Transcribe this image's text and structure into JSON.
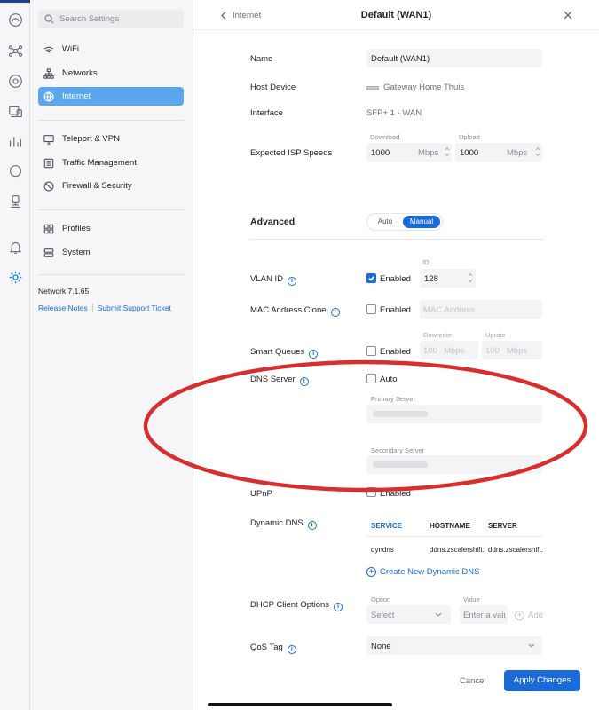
{
  "sidebar": {
    "search_placeholder": "Search Settings",
    "items": [
      {
        "label": "WiFi",
        "icon": "wifi-icon"
      },
      {
        "label": "Networks",
        "icon": "network-tree-icon"
      },
      {
        "label": "Internet",
        "icon": "globe-icon",
        "active": true
      },
      {
        "label": "Teleport & VPN",
        "icon": "monitor-icon"
      },
      {
        "label": "Traffic Management",
        "icon": "traffic-list-icon"
      },
      {
        "label": "Firewall & Security",
        "icon": "shield-icon"
      },
      {
        "label": "Profiles",
        "icon": "profiles-icon"
      },
      {
        "label": "System",
        "icon": "system-icon"
      }
    ],
    "version": "Network 7.1.65",
    "release_notes": "Release Notes",
    "support": "Submit Support Ticket"
  },
  "header": {
    "back_label": "Internet",
    "title": "Default (WAN1)"
  },
  "form": {
    "name_label": "Name",
    "name_value": "Default (WAN1)",
    "host_label": "Host Device",
    "host_value": "Gateway Home Thuis",
    "interface_label": "Interface",
    "interface_value": "SFP+ 1 - WAN",
    "speeds_label": "Expected ISP Speeds",
    "download_label": "Download",
    "download_value": "1000",
    "upload_label": "Upload",
    "upload_value": "1000",
    "unit_mbps": "Mbps",
    "advanced_label": "Advanced",
    "mode_auto": "Auto",
    "mode_manual": "Manual",
    "vlan_label": "VLAN ID",
    "vlan_enabled": "Enabled",
    "vlan_id_label": "ID",
    "vlan_id_value": "128",
    "mac_label": "MAC Address Clone",
    "mac_enabled": "Enabled",
    "mac_placeholder": "MAC Address",
    "sq_label": "Smart Queues",
    "sq_enabled": "Enabled",
    "downrate_label": "Downrate",
    "uprate_label": "Uprate",
    "downrate_placeholder": "100",
    "uprate_placeholder": "100",
    "dns_label": "DNS Server",
    "dns_auto": "Auto",
    "primary_label": "Primary Server",
    "secondary_label": "Secondary Server",
    "upnp_label": "UPnP",
    "upnp_enabled": "Enabled",
    "ddns_label": "Dynamic DNS",
    "ddns_columns": [
      "SERVICE",
      "HOSTNAME",
      "SERVER"
    ],
    "ddns_row": [
      "dyndns",
      "ddns.zscalershift.net",
      "ddns.zscalershift.net"
    ],
    "create_ddns": "Create New Dynamic DNS",
    "dhcp_label": "DHCP Client Options",
    "option_label": "Option",
    "value_label": "Value",
    "option_select": "Select",
    "value_placeholder": "Enter a value",
    "add_label": "Add",
    "qos_label": "QoS Tag",
    "qos_value": "None"
  },
  "footer": {
    "cancel": "Cancel",
    "apply": "Apply Changes"
  },
  "colors": {
    "accent": "#1a6ad9",
    "highlight_ellipse": "#d92e2e"
  }
}
